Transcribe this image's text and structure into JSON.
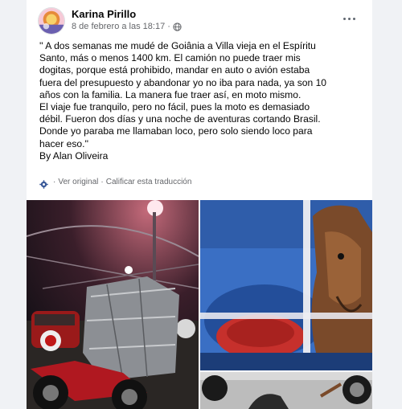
{
  "post": {
    "author": "Karina Pirillo",
    "date": "8 de febrero a las 18:17",
    "separator": "·",
    "text": "'' A dos semanas me mudé de Goiânia a Villa vieja en el Espíritu\nSanto, más o menos 1400 km. El camión no puede traer mis\ndogitas, porque está prohibido, mandar en auto o avión estaba\nfuera del presupuesto y abandonar yo no iba para nada, ya son 10\naños con la familia. La manera fue traer así, en moto mismo.\nEl viaje fue tranquilo, pero no fácil, pues la moto es demasiado\ndébil. Fueron dos días y una noche de aventuras cortando Brasil.\nDonde yo paraba me llamaban loco, pero solo siendo loco para\nhacer eso.''\nBy Alan Oliveira",
    "see_original": "Ver original",
    "rate_translation": "Calificar esta traducción",
    "translate_separator": "·"
  },
  "icons": {
    "privacy": "globe-icon",
    "options": "more-icon",
    "translation": "gear-icon"
  },
  "colors": {
    "background": "#f0f2f5",
    "card": "#ffffff",
    "text": "#050505",
    "secondary_text": "#65676b"
  }
}
